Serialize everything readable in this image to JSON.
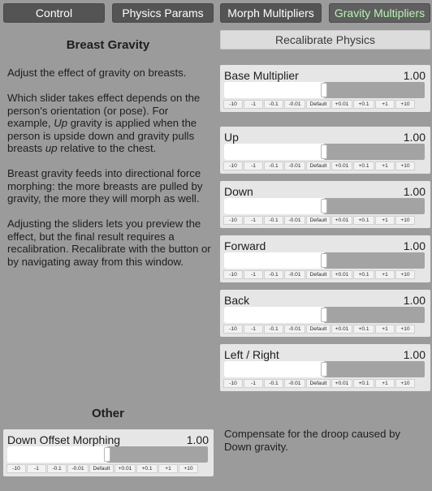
{
  "tabs": [
    {
      "label": "Control"
    },
    {
      "label": "Physics Params"
    },
    {
      "label": "Morph Multipliers"
    },
    {
      "label": "Gravity Multipliers",
      "active": true
    }
  ],
  "left": {
    "title": "Breast Gravity",
    "p1": "Adjust the effect of gravity on breasts.",
    "p2_before": "Which slider takes effect depends on the person's orientation (or pose). For example, ",
    "p2_em1": "Up",
    "p2_middle": " gravity is applied when the person is upside down and gravity pulls breasts ",
    "p2_em2": "up",
    "p2_after": " relative to the chest.",
    "p3": "Breast gravity feeds into directional force morphing: the more breasts are pulled by gravity, the more they will morph as well.",
    "p4": "Adjusting the sliders lets you preview the effect, but the final result requires a recalibration. Recalibrate with the button or by navigating away from this window."
  },
  "recalibrate_label": "Recalibrate Physics",
  "step_labels": [
    "-10",
    "-1",
    "-0.1",
    "-0.01",
    "Default",
    "+0.01",
    "+0.1",
    "+1",
    "+10"
  ],
  "sliders": [
    {
      "label": "Base Multiplier",
      "value": "1.00",
      "fraction": 0.5
    },
    {
      "label": "Up",
      "value": "1.00",
      "fraction": 0.5
    },
    {
      "label": "Down",
      "value": "1.00",
      "fraction": 0.5
    },
    {
      "label": "Forward",
      "value": "1.00",
      "fraction": 0.5
    },
    {
      "label": "Back",
      "value": "1.00",
      "fraction": 0.5
    },
    {
      "label": "Left / Right",
      "value": "1.00",
      "fraction": 0.5
    }
  ],
  "other": {
    "title": "Other",
    "slider": {
      "label": "Down Offset Morphing",
      "value": "1.00",
      "fraction": 0.5
    },
    "note": "Compensate for the droop caused by Down gravity."
  }
}
